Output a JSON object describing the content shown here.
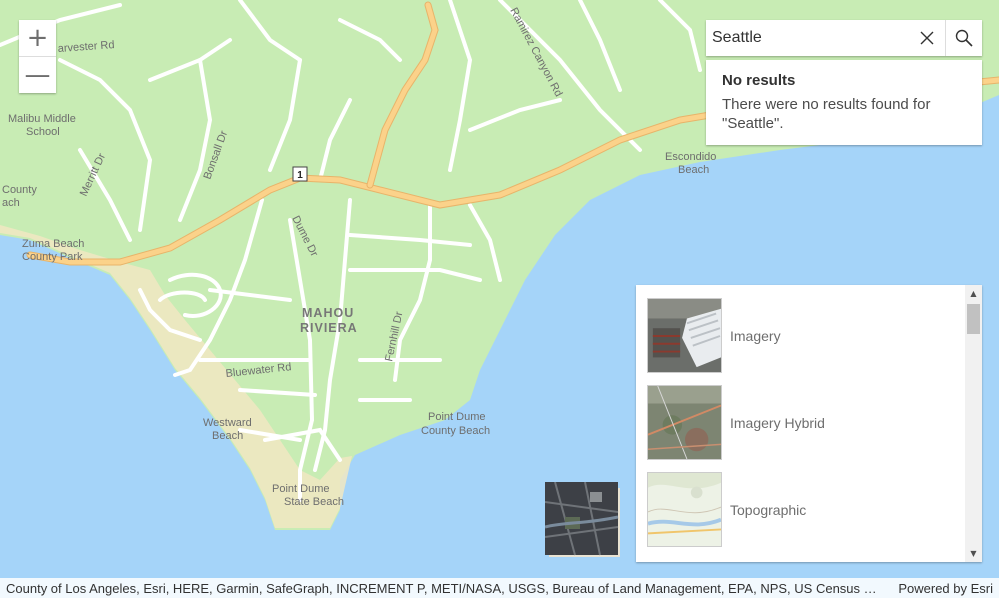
{
  "map": {
    "colors": {
      "land": "#c8ecb4",
      "water": "#a5d4f9",
      "beach": "#f1e7c2",
      "road": "#ffffff",
      "highway": "#fbd28a"
    },
    "route_shield": "1",
    "labels": {
      "harvester_rd": "arvester Rd",
      "ramirez": "Ramirez Canyon Rd",
      "malibu_school_1": "Malibu Middle",
      "malibu_school_2": "School",
      "bonsall": "Bonsall Dr",
      "merritt": "Merritt Dr",
      "county_1": "County",
      "county_2": "ach",
      "zuma_1": "Zuma Beach",
      "zuma_2": "County Park",
      "dume_dr": "Dume Dr",
      "mahou": "MAHOU",
      "riviera": "RIVIERA",
      "fernhill": "Fernhill Dr",
      "bluewater": "Bluewater Rd",
      "escondido_1": "Escondido",
      "escondido_2": "Beach",
      "westward_1": "Westward",
      "westward_2": "Beach",
      "pointdume_1": "Point Dume",
      "pointdume_2": "County Beach",
      "pdstate_1": "Point Dume",
      "pdstate_2": "State Beach"
    }
  },
  "zoom": {
    "in_label": "+",
    "out_label": "—"
  },
  "search": {
    "value": "Seattle",
    "clear_icon": "close-icon",
    "search_icon": "search-icon"
  },
  "no_results": {
    "title": "No results",
    "message": "There were no results found for \"Seattle\"."
  },
  "basemap_gallery": {
    "items": [
      {
        "label": "Imagery"
      },
      {
        "label": "Imagery Hybrid"
      },
      {
        "label": "Topographic"
      }
    ]
  },
  "attribution": {
    "sources": "County of Los Angeles, Esri, HERE, Garmin, SafeGraph, INCREMENT P, METI/NASA, USGS, Bureau of Land Management, EPA, NPS, US Census Bureau, USDA",
    "powered_by": "Powered by Esri"
  }
}
